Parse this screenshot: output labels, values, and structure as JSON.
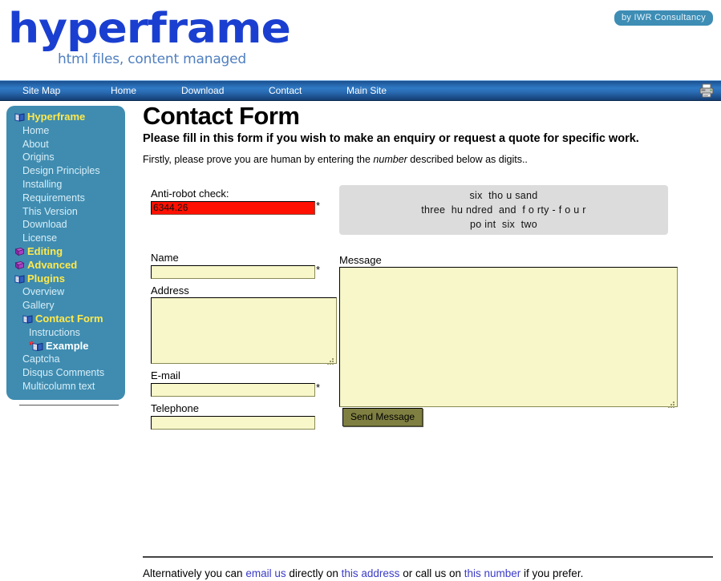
{
  "header": {
    "logo_text": "hyperframe",
    "tagline": "html files, content managed",
    "badge": "by IWR Consultancy"
  },
  "nav": {
    "items": [
      {
        "label": "Site Map"
      },
      {
        "label": "Home"
      },
      {
        "label": "Download"
      },
      {
        "label": "Contact"
      },
      {
        "label": "Main Site"
      }
    ],
    "print_icon": "printer-icon"
  },
  "sidebar": {
    "items": [
      {
        "label": "Hyperframe",
        "icon": "open-book-icon",
        "style": "bold",
        "level": 0
      },
      {
        "label": "Home",
        "icon": "",
        "style": "normal",
        "level": 1
      },
      {
        "label": "About",
        "icon": "",
        "style": "normal",
        "level": 1
      },
      {
        "label": "Origins",
        "icon": "",
        "style": "normal",
        "level": 1
      },
      {
        "label": "Design Principles",
        "icon": "",
        "style": "normal",
        "level": 1
      },
      {
        "label": "Installing",
        "icon": "",
        "style": "normal",
        "level": 1
      },
      {
        "label": "Requirements",
        "icon": "",
        "style": "normal",
        "level": 1
      },
      {
        "label": "This Version",
        "icon": "",
        "style": "normal",
        "level": 1
      },
      {
        "label": "Download",
        "icon": "",
        "style": "normal",
        "level": 1
      },
      {
        "label": "License",
        "icon": "",
        "style": "normal",
        "level": 1
      },
      {
        "label": "Editing",
        "icon": "closed-book-icon",
        "style": "bold",
        "level": 0
      },
      {
        "label": "Advanced",
        "icon": "closed-book-icon",
        "style": "bold",
        "level": 0
      },
      {
        "label": "Plugins",
        "icon": "open-book-icon",
        "style": "bold",
        "level": 0
      },
      {
        "label": "Overview",
        "icon": "",
        "style": "normal",
        "level": 1
      },
      {
        "label": "Gallery",
        "icon": "",
        "style": "normal",
        "level": 1
      },
      {
        "label": "Contact Form",
        "icon": "open-book-icon",
        "style": "bold",
        "level": 1
      },
      {
        "label": "Instructions",
        "icon": "",
        "style": "normal",
        "level": 2
      },
      {
        "label": "Example",
        "icon": "new-book-icon",
        "style": "current",
        "level": 2
      },
      {
        "label": "Captcha",
        "icon": "",
        "style": "normal",
        "level": 1
      },
      {
        "label": "Disqus Comments",
        "icon": "",
        "style": "normal",
        "level": 1
      },
      {
        "label": "Multicolumn text",
        "icon": "",
        "style": "normal",
        "level": 1
      }
    ]
  },
  "main": {
    "title": "Contact Form",
    "intro_bold": "Please fill in this form if you wish to make an enquiry or request a quote for specific work.",
    "intro_pre": "Firstly, please prove you are human by entering the ",
    "intro_em": "number",
    "intro_post": " described below as digits.."
  },
  "form": {
    "antirobot_label": "Anti-robot check:",
    "antirobot_value": "6344.26",
    "required_mark": "*",
    "captcha_lines": [
      "six  tho u sand",
      "three  hu ndred  and  f o rty - f o u r",
      "po int  six  two"
    ],
    "name_label": "Name",
    "name_value": "",
    "address_label": "Address",
    "address_value": "",
    "email_label": "E-mail",
    "email_value": "",
    "telephone_label": "Telephone",
    "telephone_value": "",
    "message_label": "Message",
    "message_value": "",
    "send_label": "Send Message"
  },
  "footer": {
    "pre": "Alternatively you can ",
    "link1": "email us",
    "mid1": " directly on ",
    "link2": "this address",
    "mid2": " or call us on ",
    "link3": "this number",
    "post": " if you prefer."
  }
}
